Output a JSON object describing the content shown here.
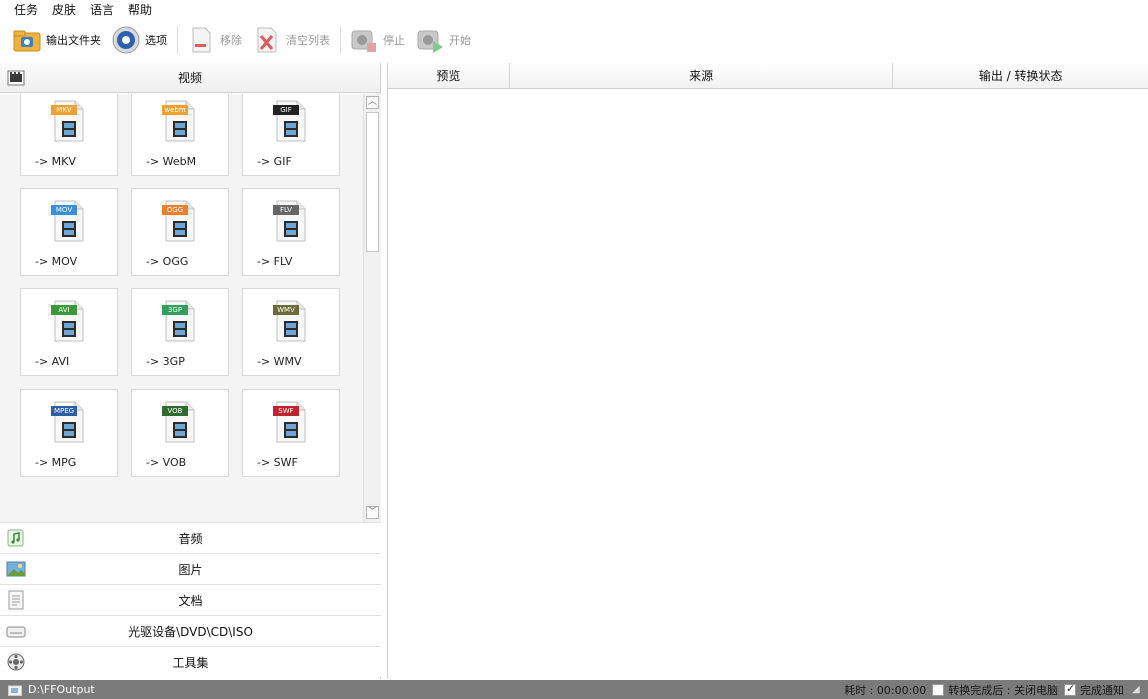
{
  "menu": [
    "任务",
    "皮肤",
    "语言",
    "帮助"
  ],
  "toolbar": {
    "output_folder": "输出文件夹",
    "options": "选项",
    "remove": "移除",
    "clear_list": "清空列表",
    "stop": "停止",
    "start": "开始"
  },
  "left": {
    "video_label": "视频",
    "tiles": [
      {
        "badge": "MKV",
        "label": "-> MKV",
        "color": "#f0a030"
      },
      {
        "badge": "webm",
        "label": "-> WebM",
        "color": "#f0a030"
      },
      {
        "badge": "GIF",
        "label": "-> GIF",
        "color": "#222222"
      },
      {
        "badge": "MOV",
        "label": "-> MOV",
        "color": "#3a8fd8"
      },
      {
        "badge": "OGG",
        "label": "-> OGG",
        "color": "#f07f2a"
      },
      {
        "badge": "FLV",
        "label": "-> FLV",
        "color": "#666666"
      },
      {
        "badge": "AVI",
        "label": "-> AVI",
        "color": "#3a9a3a"
      },
      {
        "badge": "3GP",
        "label": "-> 3GP",
        "color": "#2f9f5a"
      },
      {
        "badge": "WMV",
        "label": "-> WMV",
        "color": "#6b6b3a"
      },
      {
        "badge": "MPEG",
        "label": "-> MPG",
        "color": "#2a5fa8"
      },
      {
        "badge": "VOB",
        "label": "-> VOB",
        "color": "#2f6a2f"
      },
      {
        "badge": "SWF",
        "label": "-> SWF",
        "color": "#c0232b"
      }
    ],
    "categories": [
      "音频",
      "图片",
      "文档",
      "光驱设备\\DVD\\CD\\ISO",
      "工具集"
    ]
  },
  "table": {
    "col_preview": "预览",
    "col_source": "来源",
    "col_status": "输出 / 转换状态"
  },
  "status": {
    "path": "D:\\FFOutput",
    "elapsed": "耗时 : 00:00:00",
    "after_convert": "转换完成后 : 关闭电脑",
    "notify": "完成通知"
  }
}
